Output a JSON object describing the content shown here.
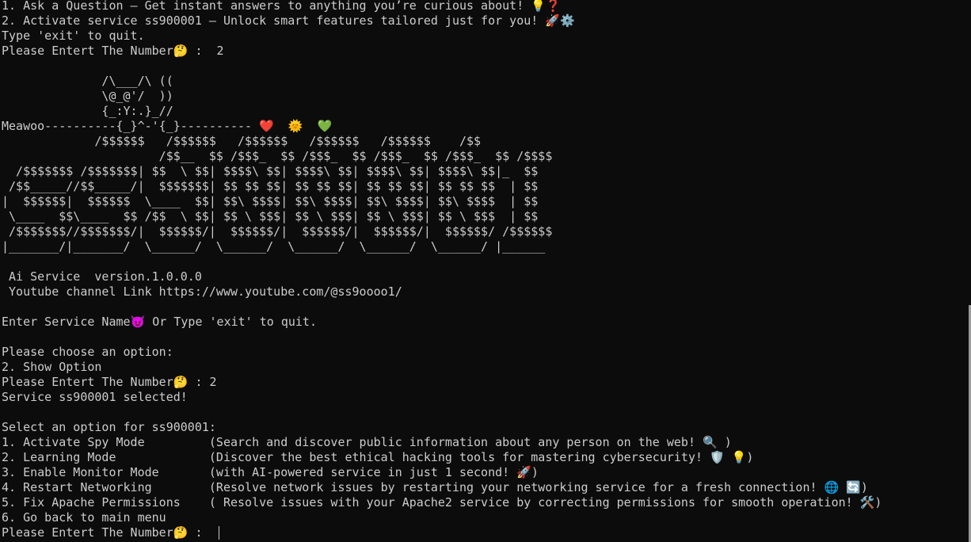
{
  "terminal": {
    "menu_line_1": "1. Ask a Question – Get instant answers to anything you’re curious about! 💡❓",
    "menu_line_2": "2. Activate service ss900001 – Unlock smart features tailored just for you! 🚀⚙️",
    "quit_hint": "Type 'exit' to quit.",
    "prompt_1": "Please Entert The Number🤔 :  2",
    "blank": "",
    "art": [
      "              /\\___/\\ ((",
      "              \\@_@'/  ))",
      "              {_:Y:.}_//",
      "Meawoo----------{_}^-'{_}---------- ❤️  🌞  💚",
      "             /$$$$$$   /$$$$$$   /$$$$$$   /$$$$$$   /$$$$$$    /$$",
      "                      /$$__  $$ /$$$_  $$ /$$$_  $$ /$$$_  $$ /$$$_  $$ /$$$$",
      "  /$$$$$$$ /$$$$$$$| $$  \\ $$| $$$$\\ $$| $$$$\\ $$| $$$$\\ $$| $$$$\\ $$|_  $$",
      " /$$_____//$$_____/|  $$$$$$$| $$ $$ $$| $$ $$ $$| $$ $$ $$| $$ $$ $$  | $$",
      "|  $$$$$$|  $$$$$$  \\____  $$| $$\\ $$$$| $$\\ $$$$| $$\\ $$$$| $$\\ $$$$  | $$",
      " \\____  $$\\____  $$ /$$  \\ $$| $$ \\ $$$| $$ \\ $$$| $$ \\ $$$| $$ \\ $$$  | $$",
      " /$$$$$$$//$$$$$$$/|  $$$$$$/|  $$$$$$/|  $$$$$$/|  $$$$$$/|  $$$$$$/ /$$$$$$",
      "|_______/|_______/  \\______/  \\______/  \\______/  \\______/  \\______/ |______"
    ],
    "version_line": " Ai Service  version.1.0.0.0",
    "youtube_line": " Youtube channel Link https://www.youtube.com/@ss9oooo1/",
    "service_prompt": "Enter Service Name😈 Or Type 'exit' to quit.",
    "choose_option": "Please choose an option:",
    "show_option": "2. Show Option",
    "prompt_2": "Please Entert The Number🤔 : 2",
    "service_selected": "Service ss900001 selected!",
    "select_option_title": "Select an option for ss900001:",
    "options": [
      "1. Activate Spy Mode         (Search and discover public information about any person on the web! 🔍 )",
      "2. Learning Mode             (Discover the best ethical hacking tools for mastering cybersecurity! 🛡️ 💡)",
      "3. Enable Monitor Mode       (with AI-powered service in just 1 second! 🚀)",
      "4. Restart Networking        (Resolve network issues by restarting your networking service for a fresh connection! 🌐 🔄)",
      "5. Fix Apache Permissions    ( Resolve issues with your Apache2 service by correcting permissions for smooth operation! 🛠️)",
      "6. Go back to main menu"
    ],
    "final_prompt": "Please Entert The Number🤔 :  "
  }
}
